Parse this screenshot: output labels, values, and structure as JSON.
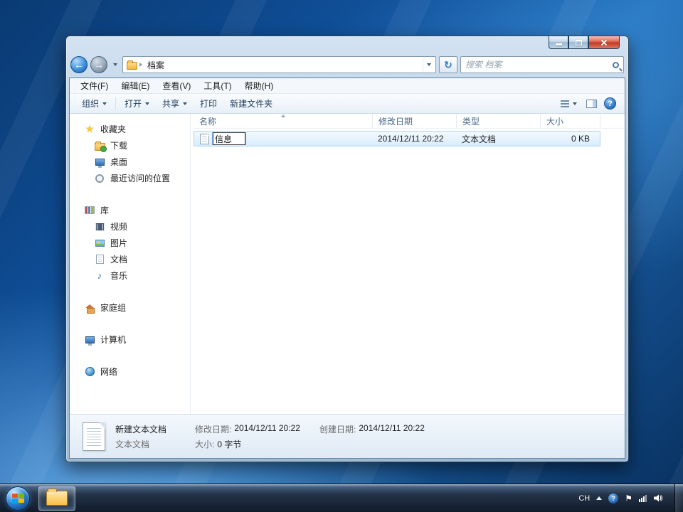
{
  "navbar": {
    "breadcrumb": "档案",
    "search_placeholder": "搜索 档案"
  },
  "menubar": {
    "items": [
      "文件(F)",
      "编辑(E)",
      "查看(V)",
      "工具(T)",
      "帮助(H)"
    ]
  },
  "toolbar": {
    "organize": "组织",
    "open": "打开",
    "share": "共享",
    "print": "打印",
    "new_folder": "新建文件夹"
  },
  "sidebar": {
    "favorites": {
      "label": "收藏夹",
      "items": [
        "下载",
        "桌面",
        "最近访问的位置"
      ]
    },
    "libraries": {
      "label": "库",
      "items": [
        "视频",
        "图片",
        "文档",
        "音乐"
      ]
    },
    "homegroup": "家庭组",
    "computer": "计算机",
    "network": "网络"
  },
  "filelist": {
    "columns": [
      "名称",
      "修改日期",
      "类型",
      "大小"
    ],
    "row": {
      "name": "信息",
      "modified": "2014/12/11 20:22",
      "type": "文本文档",
      "size": "0 KB"
    }
  },
  "details": {
    "name": "新建文本文档",
    "type": "文本文档",
    "modified_label": "修改日期:",
    "modified": "2014/12/11 20:22",
    "created_label": "创建日期:",
    "created": "2014/12/11 20:22",
    "size_label": "大小:",
    "size": "0 字节"
  },
  "taskbar": {
    "language": "CH"
  },
  "icons": {
    "back": "←",
    "forward": "→",
    "refresh": "↻",
    "star": "★",
    "music": "♪",
    "flag": "⚑",
    "help": "?"
  },
  "colors": {
    "accent_blue": "#2b7fd4",
    "selection": "#d9ecfc",
    "close_red": "#c03a26"
  }
}
